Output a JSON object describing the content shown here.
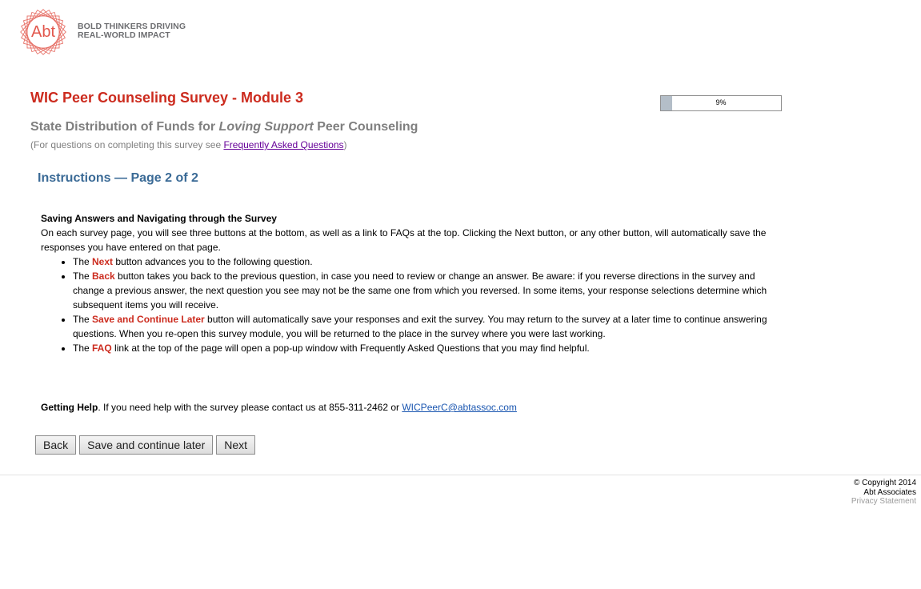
{
  "brand": {
    "logo_text": "Abt",
    "tagline_line1": "BOLD THINKERS DRIVING",
    "tagline_line2": "REAL-WORLD IMPACT",
    "color": "#e2574c"
  },
  "header": {
    "title": "WIC Peer Counseling Survey - Module 3",
    "subtitle_before": "State Distribution of Funds for ",
    "subtitle_italic": "Loving Support",
    "subtitle_after": " Peer Counseling",
    "faq_prefix": "(For questions on completing this survey see ",
    "faq_link": "Frequently Asked Questions",
    "faq_suffix": ")"
  },
  "progress": {
    "value": 0.09,
    "label": "9%"
  },
  "instructions": {
    "title": "Instructions — Page 2 of 2",
    "section_heading": "Saving Answers and Navigating through the Survey",
    "intro": "On each survey page, you will see three buttons at the bottom, as well as a link to FAQs at the top.  Clicking the Next button, or any other button, will automatically save the responses you have entered on that page.",
    "bullets": [
      {
        "pre": "The ",
        "key": "Next",
        "post": " button advances you to the following question."
      },
      {
        "pre": "The ",
        "key": "Back",
        "post": " button takes you back to the previous question, in case you need to review or change an answer.  Be aware:  if you reverse directions in the survey and change a previous answer, the next question you see may not be the same one from which you reversed.  In some items, your response selections determine which subsequent items you will receive."
      },
      {
        "pre": "The ",
        "key": "Save and Continue Later",
        "post": " button will automatically save your responses and exit the survey.  You may return to the survey at a later time to continue answering questions.  When you re-open this survey module, you will be returned to the place in the survey where you were last working."
      },
      {
        "pre": "The ",
        "key": "FAQ",
        "post": " link at the top of the page will open a pop-up window with Frequently Asked Questions that you may find helpful."
      }
    ]
  },
  "help": {
    "label": "Getting Help",
    "text": ".  If you need help with the survey please contact us at 855-311-2462 or ",
    "email": "WICPeerC@abtassoc.com"
  },
  "buttons": {
    "back": "Back",
    "save": "Save and continue later",
    "next": "Next"
  },
  "footer": {
    "copyright": "© Copyright 2014",
    "company": "Abt Associates",
    "privacy": "Privacy Statement"
  }
}
